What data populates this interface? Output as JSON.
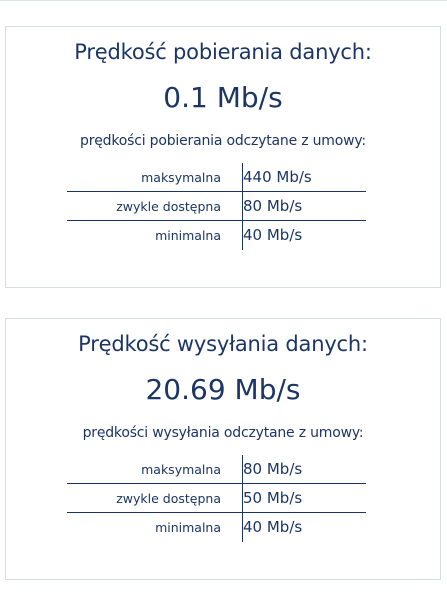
{
  "download": {
    "title": "Prędkość pobierania danych:",
    "value": "0.1 Mb/s",
    "subtitle": "prędkości pobierania odczytane z umowy:",
    "rows": [
      {
        "label": "maksymalna",
        "value": "440 Mb/s"
      },
      {
        "label": "zwykle dostępna",
        "value": "80 Mb/s"
      },
      {
        "label": "minimalna",
        "value": "40 Mb/s"
      }
    ]
  },
  "upload": {
    "title": "Prędkość wysyłania danych:",
    "value": "20.69 Mb/s",
    "subtitle": "prędkości wysyłania odczytane z umowy:",
    "rows": [
      {
        "label": "maksymalna",
        "value": "80 Mb/s"
      },
      {
        "label": "zwykle dostępna",
        "value": "50 Mb/s"
      },
      {
        "label": "minimalna",
        "value": "40 Mb/s"
      }
    ]
  },
  "colors": {
    "text": "#1b3566",
    "border": "#d8dde3",
    "background": "#ffffff"
  }
}
